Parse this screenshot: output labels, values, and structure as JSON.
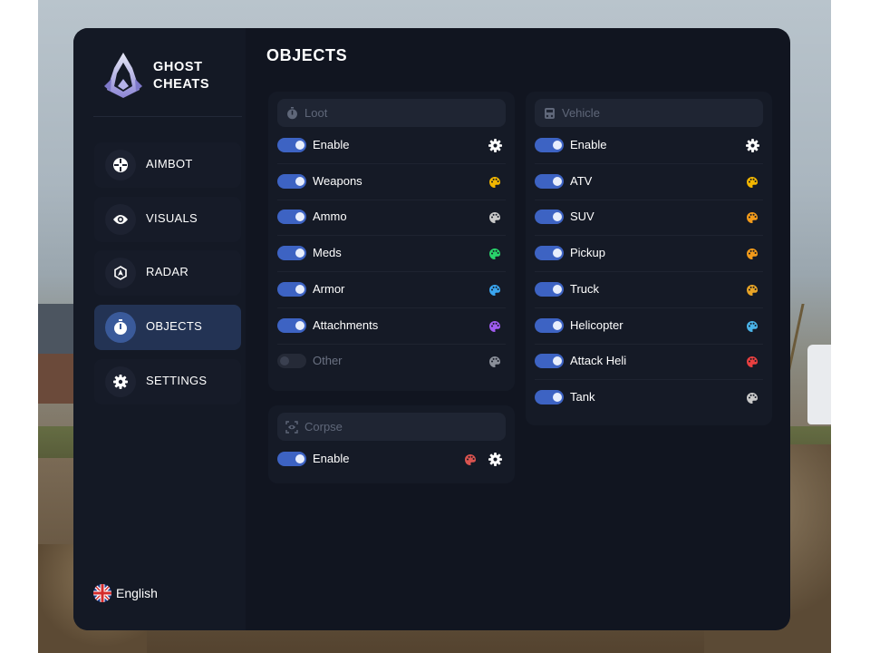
{
  "brand": {
    "line1": "GHOST",
    "line2": "CHEATS"
  },
  "page_title": "OBJECTS",
  "nav": [
    {
      "label": "AIMBOT",
      "icon": "crosshair-icon"
    },
    {
      "label": "VISUALS",
      "icon": "eye-icon"
    },
    {
      "label": "RADAR",
      "icon": "radar-icon"
    },
    {
      "label": "OBJECTS",
      "icon": "timer-icon",
      "active": true
    },
    {
      "label": "SETTINGS",
      "icon": "gear-icon"
    }
  ],
  "language": {
    "label": "English",
    "icon": "uk-flag-icon"
  },
  "loot": {
    "title": "Loot",
    "rows": [
      {
        "label": "Enable",
        "on": true,
        "action": "gear-icon"
      },
      {
        "label": "Weapons",
        "on": true,
        "color": "#f2b600"
      },
      {
        "label": "Ammo",
        "on": true,
        "color": "#c9c9c9"
      },
      {
        "label": "Meds",
        "on": true,
        "color": "#29d36b"
      },
      {
        "label": "Armor",
        "on": true,
        "color": "#3aa6f0"
      },
      {
        "label": "Attachments",
        "on": true,
        "color": "#a05cf0"
      },
      {
        "label": "Other",
        "on": false,
        "color": "#8a8f99"
      }
    ]
  },
  "corpse": {
    "title": "Corpse",
    "rows": [
      {
        "label": "Enable",
        "on": true,
        "color": "#d9534f",
        "action": "gear-icon"
      }
    ]
  },
  "vehicle": {
    "title": "Vehicle",
    "rows": [
      {
        "label": "Enable",
        "on": true,
        "action": "gear-icon"
      },
      {
        "label": "ATV",
        "on": true,
        "color": "#f2b600"
      },
      {
        "label": "SUV",
        "on": true,
        "color": "#f29a1a"
      },
      {
        "label": "Pickup",
        "on": true,
        "color": "#f29a1a"
      },
      {
        "label": "Truck",
        "on": true,
        "color": "#e8a426"
      },
      {
        "label": "Helicopter",
        "on": true,
        "color": "#4ab3e8"
      },
      {
        "label": "Attack Heli",
        "on": true,
        "color": "#e84040"
      },
      {
        "label": "Tank",
        "on": true,
        "color": "#c9c9c9"
      }
    ]
  }
}
